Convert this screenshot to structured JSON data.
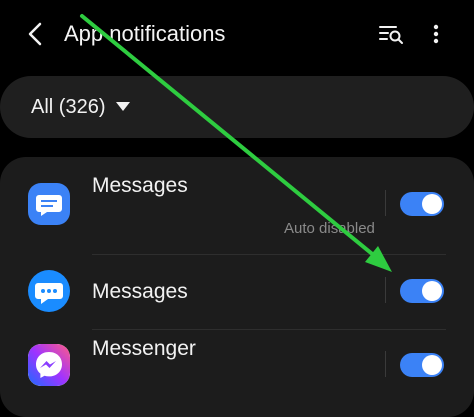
{
  "header": {
    "title": "App notifications",
    "back_icon": "chevron-left-icon",
    "search_icon": "filter-search-icon",
    "more_icon": "more-vertical-icon"
  },
  "filter": {
    "label": "All (326)",
    "caret_icon": "caret-down-icon"
  },
  "apps": [
    {
      "name": "Messages",
      "subtitle": "Auto disabled",
      "toggle_on": true,
      "icon": "samsung-messages-icon",
      "color": "#3b82f6"
    },
    {
      "name": "Messages",
      "subtitle": "",
      "toggle_on": true,
      "icon": "google-messages-icon",
      "color": "#1a8cff"
    },
    {
      "name": "Messenger",
      "subtitle": "",
      "toggle_on": true,
      "icon": "facebook-messenger-icon",
      "color": "#7b3ff2"
    }
  ],
  "colors": {
    "accent": "#3b82f6",
    "annotation_arrow": "#2ecc40",
    "background": "#000000",
    "card": "#1c1c1c"
  }
}
